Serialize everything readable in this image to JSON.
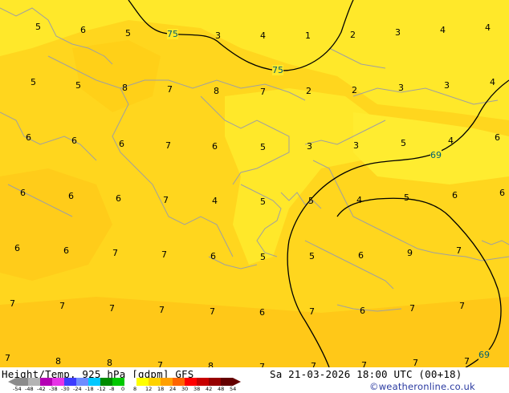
{
  "title": "Height/Temp. 925 hPa [gdpm] GFS",
  "valid_time": "Sa 21-03-2026 18:00 UTC (00+18)",
  "credit": "©weatheronline.co.uk",
  "contour_labels": [
    "75",
    "75",
    "69",
    "69"
  ],
  "temperature_values": [
    {
      "v": "5"
    },
    {
      "v": "6"
    },
    {
      "v": "5"
    },
    {
      "v": "3"
    },
    {
      "v": "4"
    },
    {
      "v": "1"
    },
    {
      "v": "2"
    },
    {
      "v": "3"
    },
    {
      "v": "4"
    },
    {
      "v": "4"
    },
    {
      "v": "5"
    },
    {
      "v": "5"
    },
    {
      "v": "8"
    },
    {
      "v": "7"
    },
    {
      "v": "8"
    },
    {
      "v": "7"
    },
    {
      "v": "2"
    },
    {
      "v": "2"
    },
    {
      "v": "3"
    },
    {
      "v": "3"
    },
    {
      "v": "4"
    },
    {
      "v": "6"
    },
    {
      "v": "6"
    },
    {
      "v": "6"
    },
    {
      "v": "7"
    },
    {
      "v": "6"
    },
    {
      "v": "5"
    },
    {
      "v": "3"
    },
    {
      "v": "3"
    },
    {
      "v": "5"
    },
    {
      "v": "4"
    },
    {
      "v": "6"
    },
    {
      "v": "6"
    },
    {
      "v": "6"
    },
    {
      "v": "6"
    },
    {
      "v": "7"
    },
    {
      "v": "4"
    },
    {
      "v": "5"
    },
    {
      "v": "5"
    },
    {
      "v": "4"
    },
    {
      "v": "5"
    },
    {
      "v": "6"
    },
    {
      "v": "6"
    },
    {
      "v": "6"
    },
    {
      "v": "6"
    },
    {
      "v": "7"
    },
    {
      "v": "7"
    },
    {
      "v": "6"
    },
    {
      "v": "5"
    },
    {
      "v": "5"
    },
    {
      "v": "6"
    },
    {
      "v": "9"
    },
    {
      "v": "7"
    },
    {
      "v": "7"
    },
    {
      "v": "7"
    },
    {
      "v": "7"
    },
    {
      "v": "7"
    },
    {
      "v": "7"
    },
    {
      "v": "6"
    },
    {
      "v": "7"
    },
    {
      "v": "6"
    },
    {
      "v": "7"
    },
    {
      "v": "7"
    },
    {
      "v": "7"
    },
    {
      "v": "8"
    },
    {
      "v": "8"
    },
    {
      "v": "7"
    },
    {
      "v": "8"
    },
    {
      "v": "7"
    },
    {
      "v": "7"
    },
    {
      "v": "7"
    },
    {
      "v": "7"
    },
    {
      "v": "7"
    },
    {
      "v": "8"
    }
  ],
  "legend": {
    "ticks": [
      "-54",
      "-48",
      "-42",
      "-38",
      "-30",
      "-24",
      "-18",
      "-12",
      "-8",
      "0",
      "8",
      "12",
      "18",
      "24",
      "30",
      "38",
      "42",
      "48",
      "54"
    ],
    "colors": [
      "#8c8c8c",
      "#b4b4b4",
      "#b400b4",
      "#e632e6",
      "#3c3cff",
      "#6e8cff",
      "#00c8ff",
      "#008c00",
      "#00c800",
      "#ffffff",
      "#ffff00",
      "#ffd200",
      "#ffa000",
      "#ff6400",
      "#ff0000",
      "#c80000",
      "#960000",
      "#640000"
    ]
  }
}
